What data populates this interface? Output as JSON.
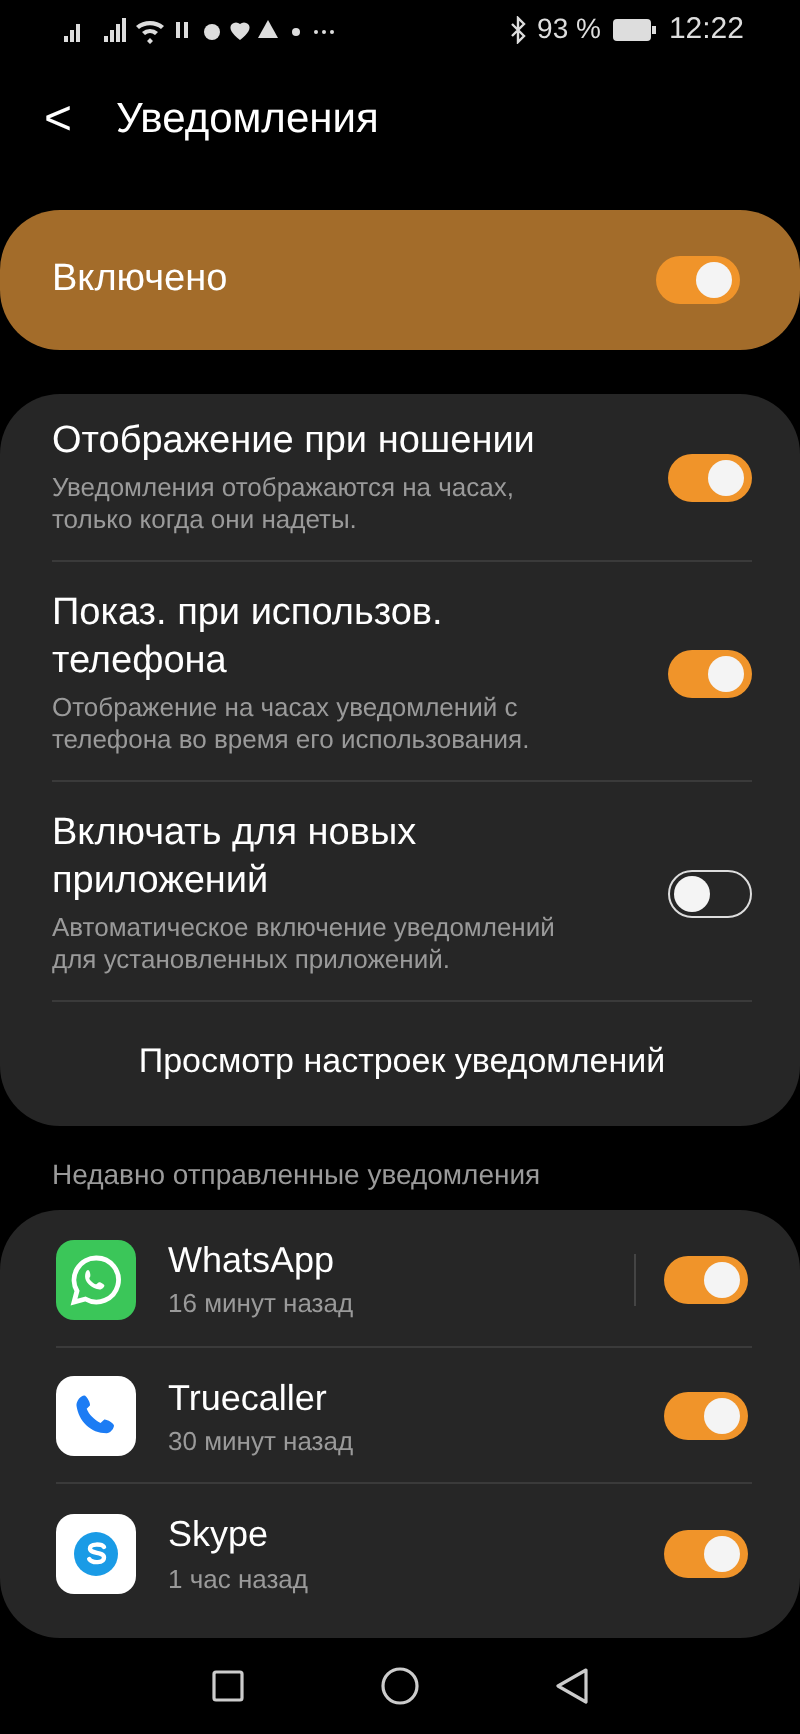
{
  "status_bar": {
    "battery": "93 %",
    "time": "12:22"
  },
  "header": {
    "back": "<",
    "title": "Уведомления"
  },
  "master": {
    "label": "Включено",
    "on": true
  },
  "settings": [
    {
      "kind": "toggle",
      "title": "Отображение при ношении",
      "subtitle": "Уведомления отображаются на часах, только когда они надеты.",
      "on": true
    },
    {
      "kind": "toggle",
      "title": "Показ. при использов. телефона",
      "subtitle": "Отображение на часах уведомлений с телефона во время его использования.",
      "on": true
    },
    {
      "kind": "toggle",
      "title": "Включать для новых приложений",
      "subtitle": "Автоматическое включение уведомлений для установленных приложений.",
      "on": false
    },
    {
      "kind": "link",
      "title": "Просмотр настроек уведомлений"
    }
  ],
  "recent_label": "Недавно отправленные уведомления",
  "apps": [
    {
      "kind": "whatsapp",
      "name": "WhatsApp",
      "time": "16 минут назад",
      "on": true,
      "separator": true
    },
    {
      "kind": "truecaller",
      "name": "Truecaller",
      "time": "30 минут назад",
      "on": true,
      "separator": false
    },
    {
      "kind": "skype",
      "name": "Skype",
      "time": "1 час назад",
      "on": true,
      "separator": false
    }
  ]
}
